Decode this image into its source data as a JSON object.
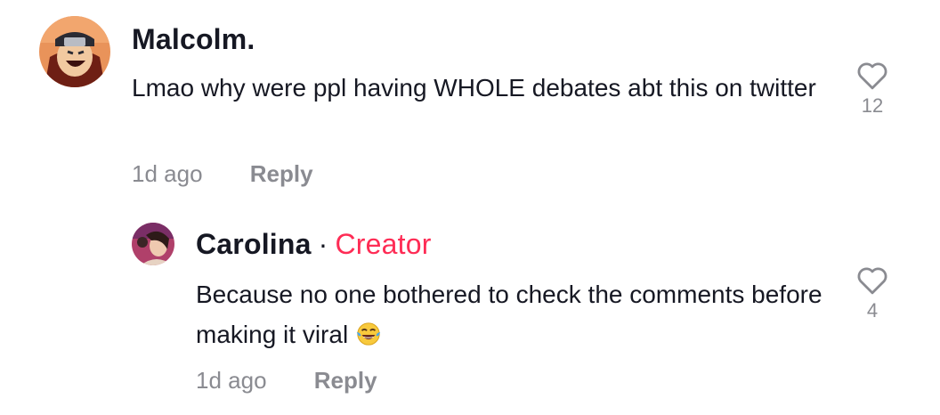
{
  "comments": [
    {
      "username": "Malcolm.",
      "text": "Lmao why were ppl having WHOLE debates abt this on twitter",
      "time": "1d ago",
      "reply_label": "Reply",
      "likes": "12",
      "avatar_icon": "anime-character-avatar",
      "like_icon": "heart-outline-icon"
    },
    {
      "username": "Carolina",
      "separator": "·",
      "badge": "Creator",
      "text": "Because no one bothered to check the comments before making it viral",
      "emoji": "😂",
      "time": "1d ago",
      "reply_label": "Reply",
      "likes": "4",
      "avatar_icon": "user-photo-avatar",
      "like_icon": "heart-outline-icon"
    }
  ],
  "colors": {
    "text": "#161823",
    "secondary": "#8a8b91",
    "creator_badge": "#fe2c55",
    "background": "#ffffff"
  }
}
